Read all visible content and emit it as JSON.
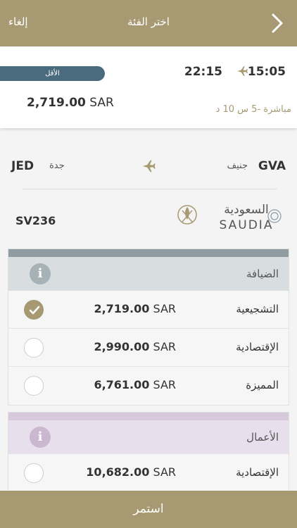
{
  "header": {
    "title": "اختر الفئة",
    "cancel_label": "إلغاء"
  },
  "flight": {
    "departure_time": "15:05",
    "arrival_time": "22:15",
    "badge": "الأقل",
    "price_amount": "2,719.00",
    "currency": "SAR",
    "duration": "مباشرة -5 س 10 د"
  },
  "route": {
    "origin_code": "GVA",
    "origin_city": "جنيف",
    "destination_code": "JED",
    "destination_city": "جدة"
  },
  "airline": {
    "logo_arabic": "السعودية",
    "logo_latin": "SAUDIA",
    "flight_number": "SV236"
  },
  "classes": [
    {
      "name": "الضيافة",
      "stripe_color": "#8f9ca2",
      "header_color": "#d8dde0",
      "icon_color": "#a7b2b7",
      "fares": [
        {
          "name": "التشجيعية",
          "amount": "2,719.00",
          "currency": "SAR",
          "selected": true
        },
        {
          "name": "الإقتصادية",
          "amount": "2,990.00",
          "currency": "SAR",
          "selected": false
        },
        {
          "name": "المميزة",
          "amount": "6,761.00",
          "currency": "SAR",
          "selected": false
        }
      ]
    },
    {
      "name": "الأعمال",
      "stripe_color": "#d7c9dc",
      "header_color": "#e8dfec",
      "icon_color": "#c9b8cf",
      "fares": [
        {
          "name": "الإقتصادية",
          "amount": "10,682.00",
          "currency": "SAR",
          "selected": false
        }
      ]
    }
  ],
  "footer": {
    "continue_label": "استمر"
  },
  "colors": {
    "gold": "#a79a72",
    "badge": "#4a6b7e"
  }
}
